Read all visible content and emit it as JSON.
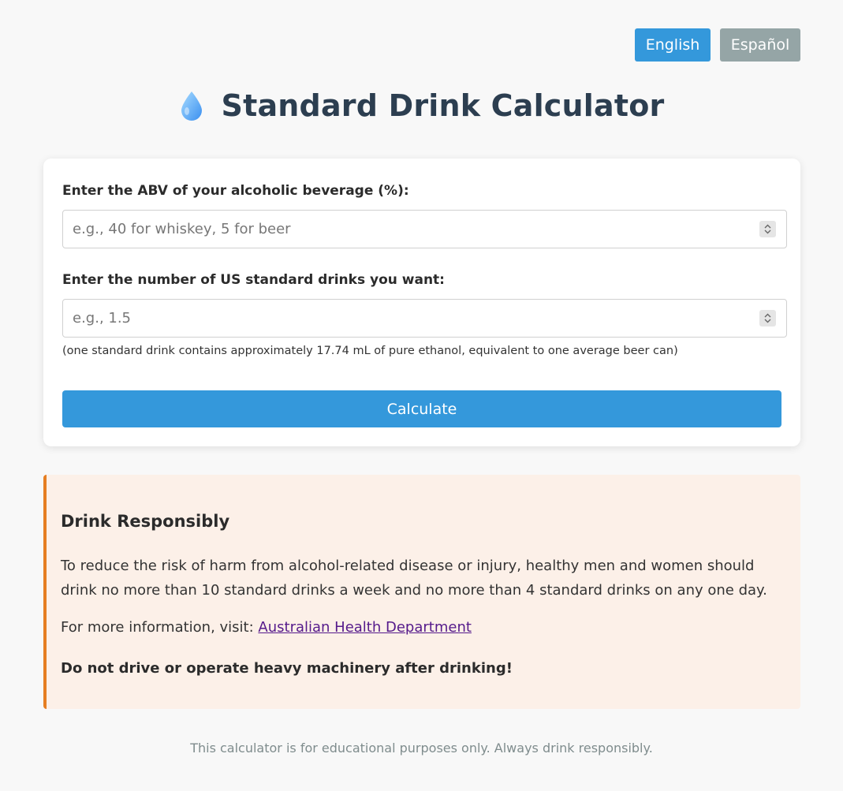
{
  "lang": {
    "english": "English",
    "spanish": "Español"
  },
  "header": {
    "title": "Standard Drink Calculator",
    "icon": "water-drop-icon"
  },
  "form": {
    "abv_label": "Enter the ABV of your alcoholic beverage (%):",
    "abv_placeholder": "e.g., 40 for whiskey, 5 for beer",
    "drinks_label": "Enter the number of US standard drinks you want:",
    "drinks_placeholder": "e.g., 1.5",
    "hint": "(one standard drink contains approximately 17.74 mL of pure ethanol, equivalent to one average beer can)",
    "calculate_label": "Calculate"
  },
  "warning": {
    "title": "Drink Responsibly",
    "text": "To reduce the risk of harm from alcohol-related disease or injury, healthy men and women should drink no more than 10 standard drinks a week and no more than 4 standard drinks on any one day.",
    "info_prefix": "For more information, visit: ",
    "link_text": "Australian Health Department",
    "bold_text": "Do not drive or operate heavy machinery after drinking!"
  },
  "footer": {
    "text": "This calculator is for educational purposes only. Always drink responsibly."
  },
  "colors": {
    "accent": "#3498db",
    "inactive": "#95a5a6",
    "title": "#2c3e50",
    "warning_border": "#e67e22",
    "warning_bg": "#fcf0e8"
  }
}
